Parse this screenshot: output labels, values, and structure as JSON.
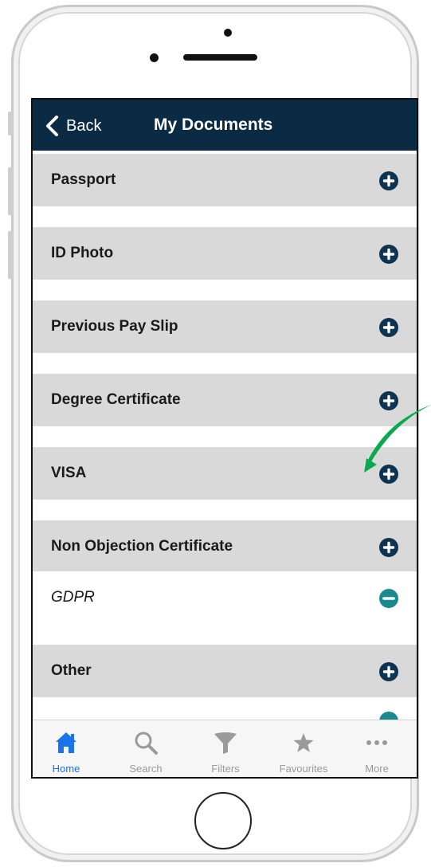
{
  "navbar": {
    "back_label": "Back",
    "title": "My Documents"
  },
  "documents": [
    {
      "label": "Passport",
      "action": "plus-circle-icon"
    },
    {
      "label": "ID Photo",
      "action": "plus-circle-icon"
    },
    {
      "label": "Previous Pay Slip",
      "action": "plus-circle-icon"
    },
    {
      "label": "Degree Certificate",
      "action": "plus-circle-icon"
    },
    {
      "label": "VISA",
      "action": "plus-circle-icon"
    },
    {
      "label": "Non Objection Certificate",
      "action": "plus-circle-icon"
    },
    {
      "label": "GDPR",
      "action": "minus-circle-icon"
    },
    {
      "label": "Other",
      "action": "plus-circle-icon"
    }
  ],
  "tabbar": {
    "tabs": [
      {
        "label": "Home",
        "icon": "home-icon",
        "active": true
      },
      {
        "label": "Search",
        "icon": "search-icon",
        "active": false
      },
      {
        "label": "Filters",
        "icon": "funnel-icon",
        "active": false
      },
      {
        "label": "Favourites",
        "icon": "star-icon",
        "active": false
      },
      {
        "label": "More",
        "icon": "more-dots-icon",
        "active": false
      }
    ]
  },
  "colors": {
    "navbar_bg": "#0b2a43",
    "row_bg": "#d9d9d9",
    "plus_button": "#0e3452",
    "minus_button": "#1b8a8f",
    "active_tab": "#1a73e8",
    "annotation_arrow": "#0aa84f"
  }
}
